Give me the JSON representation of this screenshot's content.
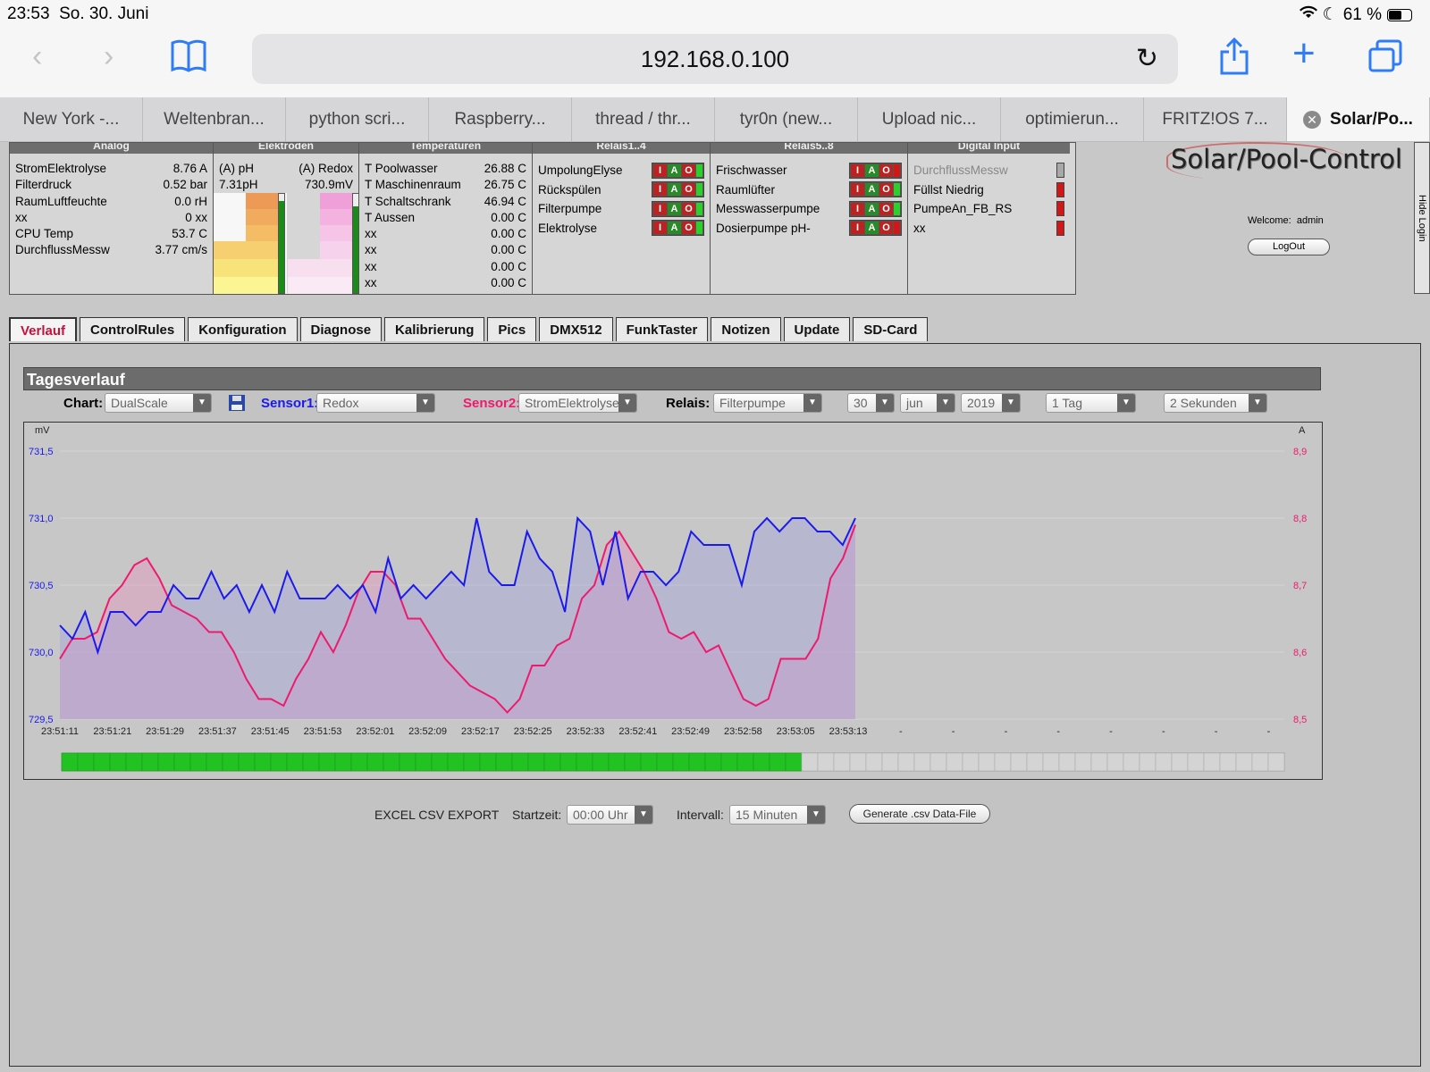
{
  "status": {
    "time": "23:53",
    "date": "So. 30. Juni",
    "battery": "61 %"
  },
  "browser": {
    "url": "192.168.0.100",
    "tabs": [
      "New York -...",
      "Weltenbran...",
      "python scri...",
      "Raspberry...",
      "thread / thr...",
      "tyr0n (new...",
      "Upload nic...",
      "optimierun...",
      "FRITZ!OS 7...",
      "Solar/Po..."
    ]
  },
  "sensors": {
    "analog": {
      "title": "Analog",
      "rows": [
        [
          "StromElektrolyse",
          "8.76 A"
        ],
        [
          "Filterdruck",
          "0.52 bar"
        ],
        [
          "RaumLuftfeuchte",
          "0.0 rH"
        ],
        [
          "xx",
          "0 xx"
        ],
        [
          "CPU Temp",
          "53.7 C"
        ],
        [
          "DurchflussMessw",
          "3.77 cm/s"
        ]
      ]
    },
    "elektroden": {
      "title": "Elektroden",
      "ph_label": "(A) pH",
      "redox_label": "(A) Redox",
      "ph_value": "7.31pH",
      "redox_value": "730.9mV"
    },
    "temperaturen": {
      "title": "Temperaturen",
      "rows": [
        [
          "T Poolwasser",
          "26.88 C"
        ],
        [
          "T Maschinenraum",
          "26.75 C"
        ],
        [
          "T Schaltschrank",
          "46.94 C"
        ],
        [
          "T Aussen",
          "0.00 C"
        ],
        [
          "xx",
          "0.00 C"
        ],
        [
          "xx",
          "0.00 C"
        ],
        [
          "xx",
          "0.00 C"
        ],
        [
          "xx",
          "0.00 C"
        ]
      ]
    },
    "relais1": {
      "title": "Relais1..4",
      "rows": [
        "UmpolungElyse",
        "Rückspülen",
        "Filterpumpe",
        "Elektrolyse"
      ],
      "state_colors": [
        "#2bd02b",
        "#2bd02b",
        "#2bd02b",
        "#2bd02b"
      ]
    },
    "relais2": {
      "title": "Relais5..8",
      "rows": [
        "Frischwasser",
        "Raumlüfter",
        "Messwasserpumpe",
        "Dosierpumpe pH-"
      ],
      "state_colors": [
        "#d01818",
        "#2bd02b",
        "#2bd02b",
        "#d01818"
      ]
    },
    "digital": {
      "title": "Digital Input",
      "rows": [
        "DurchflussMessw",
        "Füllst Niedrig",
        "PumpeAn_FB_RS",
        "xx"
      ],
      "led_colors": [
        "#a8a8a8",
        "#d01818",
        "#d01818",
        "#d01818"
      ]
    },
    "iao": [
      "I",
      "A",
      "O"
    ]
  },
  "logo": "Solar/Pool-Control",
  "welcome": {
    "label": "Welcome:",
    "user": "admin"
  },
  "logout": "LogOut",
  "hide_login": "Hide Login",
  "page_tabs": [
    "Verlauf",
    "ControlRules",
    "Konfiguration",
    "Diagnose",
    "Kalibrierung",
    "Pics",
    "DMX512",
    "FunkTaster",
    "Notizen",
    "Update",
    "SD-Card"
  ],
  "panel": {
    "title": "Tagesverlauf",
    "controls": {
      "chart_label": "Chart:",
      "chart_value": "DualScale",
      "sensor1_label": "Sensor1:",
      "sensor1_value": "Redox",
      "sensor2_label": "Sensor2:",
      "sensor2_value": "StromElektrolyse",
      "relais_label": "Relais:",
      "relais_value": "Filterpumpe",
      "day": "30",
      "month": "jun",
      "year": "2019",
      "range": "1 Tag",
      "interval": "2 Sekunden"
    },
    "csv": {
      "label": "EXCEL CSV EXPORT",
      "start_label": "Startzeit:",
      "start_value": "00:00 Uhr",
      "interval_label": "Intervall:",
      "interval_value": "15 Minuten",
      "button": "Generate .csv Data-File"
    },
    "progress_fraction": 0.6
  },
  "colors": {
    "sensor1": "#1a1aee",
    "sensor2": "#ee1a6e",
    "active_tab": "#c8103a"
  },
  "chart_data": {
    "type": "line",
    "left_unit": "mV",
    "right_unit": "A",
    "left_ylim": [
      729.5,
      731.5
    ],
    "right_ylim": [
      8.5,
      8.9
    ],
    "left_ticks": [
      "731,5",
      "731,0",
      "730,5",
      "730,0",
      "729,5"
    ],
    "right_ticks": [
      "8,9",
      "8,8",
      "8,7",
      "8,6",
      "8,5"
    ],
    "x_labels": [
      "23:51:11",
      "23:51:21",
      "23:51:29",
      "23:51:37",
      "23:51:45",
      "23:51:53",
      "23:52:01",
      "23:52:09",
      "23:52:17",
      "23:52:25",
      "23:52:33",
      "23:52:41",
      "23:52:49",
      "23:52:58",
      "23:53:05",
      "23:53:13",
      "-",
      "-",
      "-",
      "-",
      "-",
      "-",
      "-",
      "-"
    ],
    "grid": true,
    "series": [
      {
        "name": "Redox",
        "axis": "left",
        "color": "#1a1aee",
        "values": [
          730.2,
          730.1,
          730.3,
          730.0,
          730.3,
          730.3,
          730.2,
          730.3,
          730.3,
          730.5,
          730.4,
          730.4,
          730.6,
          730.4,
          730.5,
          730.3,
          730.5,
          730.3,
          730.6,
          730.4,
          730.4,
          730.4,
          730.5,
          730.4,
          730.5,
          730.3,
          730.7,
          730.4,
          730.5,
          730.4,
          730.5,
          730.6,
          730.5,
          731.0,
          730.6,
          730.5,
          730.5,
          730.9,
          730.7,
          730.6,
          730.3,
          731.0,
          730.9,
          730.5,
          730.9,
          730.4,
          730.6,
          730.6,
          730.5,
          730.6,
          730.9,
          730.8,
          730.8,
          730.8,
          730.5,
          730.9,
          731.0,
          730.9,
          731.0,
          731.0,
          730.9,
          730.9,
          730.8,
          731.0
        ]
      },
      {
        "name": "StromElektrolyse",
        "axis": "right",
        "color": "#ee1a6e",
        "values": [
          8.59,
          8.62,
          8.62,
          8.63,
          8.68,
          8.7,
          8.73,
          8.74,
          8.71,
          8.67,
          8.66,
          8.65,
          8.63,
          8.63,
          8.6,
          8.56,
          8.53,
          8.53,
          8.52,
          8.56,
          8.59,
          8.63,
          8.6,
          8.64,
          8.69,
          8.72,
          8.72,
          8.7,
          8.65,
          8.65,
          8.62,
          8.59,
          8.57,
          8.55,
          8.54,
          8.53,
          8.51,
          8.53,
          8.58,
          8.58,
          8.61,
          8.62,
          8.68,
          8.7,
          8.76,
          8.78,
          8.75,
          8.72,
          8.68,
          8.63,
          8.62,
          8.63,
          8.6,
          8.61,
          8.57,
          8.53,
          8.52,
          8.53,
          8.59,
          8.59,
          8.59,
          8.62,
          8.71,
          8.74,
          8.79
        ]
      }
    ]
  }
}
